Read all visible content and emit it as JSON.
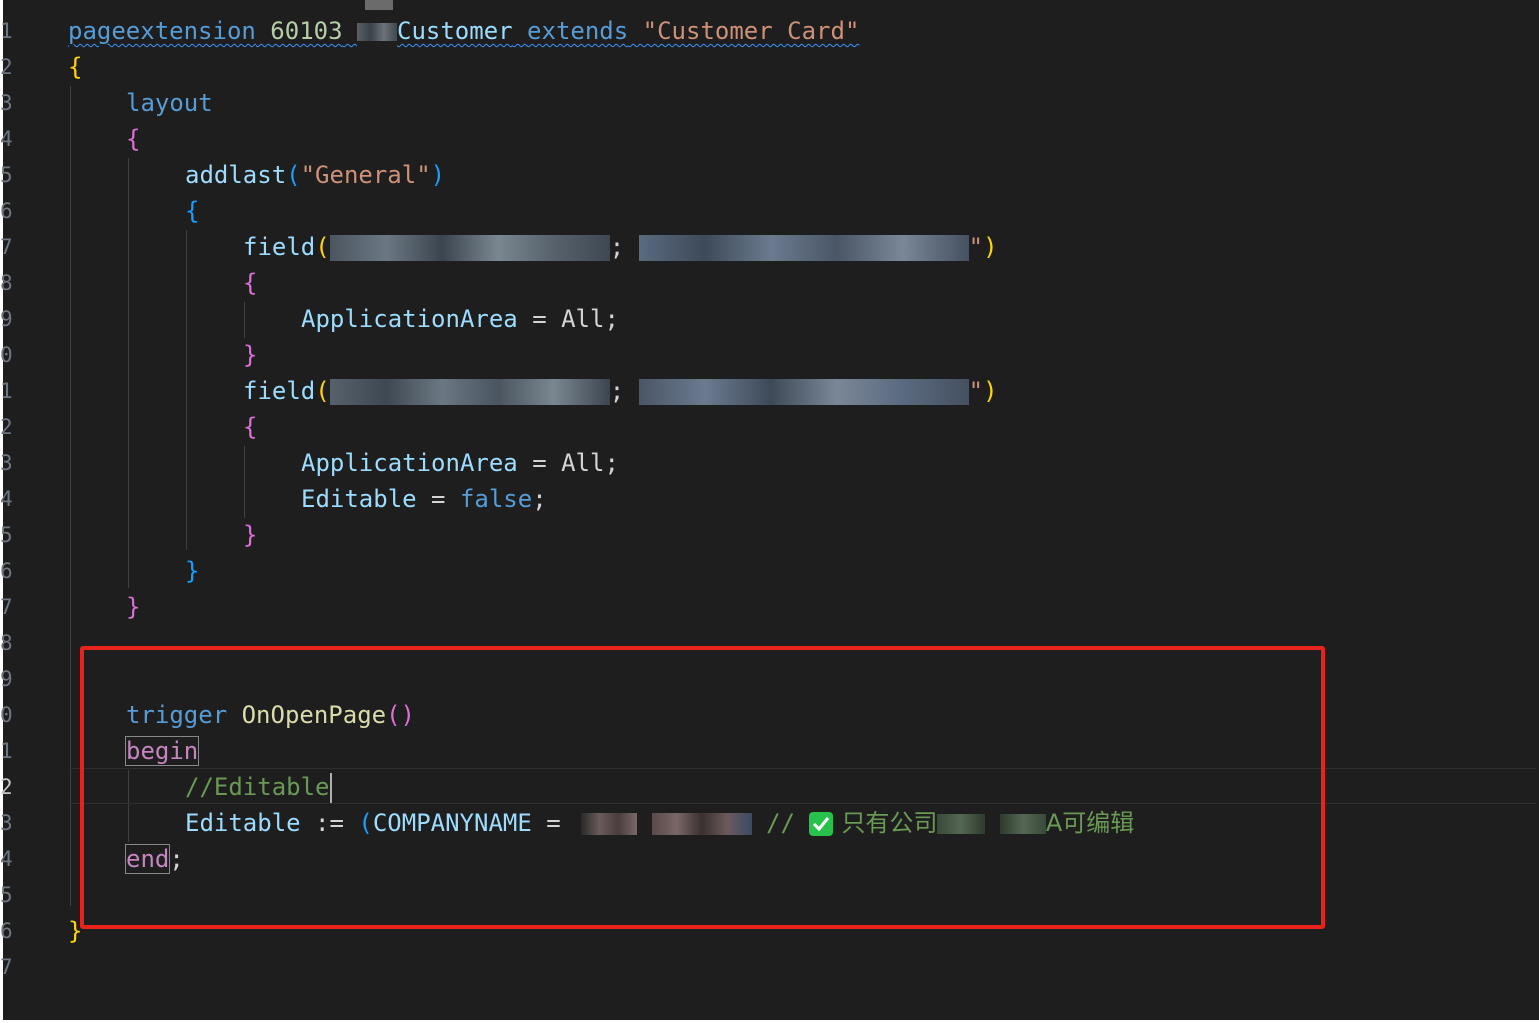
{
  "line_numbers": [
    "1",
    "2",
    "3",
    "4",
    "5",
    "6",
    "7",
    "8",
    "9",
    "0",
    "1",
    "2",
    "3",
    "4",
    "5",
    "6",
    "7",
    "8",
    "9",
    "0",
    "1",
    "2",
    "3",
    "4",
    "5",
    "6",
    "7"
  ],
  "active_line_index": 21,
  "code": {
    "l1": {
      "kw": "pageextension",
      "num": "60103",
      "name_tail": "Customer",
      "extends_kw": "extends",
      "target": "\"Customer Card\""
    },
    "l2": {
      "brace": "{"
    },
    "l3": {
      "kw": "layout"
    },
    "l4": {
      "brace": "{"
    },
    "l5": {
      "fn": "addlast",
      "open": "(",
      "arg": "\"General\"",
      "close": ")"
    },
    "l6": {
      "brace": "{"
    },
    "l7": {
      "kw": "field",
      "open": "(",
      "sep": ";",
      "close_quote": "\"",
      "close": ")"
    },
    "l8": {
      "brace": "{"
    },
    "l9": {
      "prop": "ApplicationArea",
      "eq": "=",
      "val": "All",
      "semi": ";"
    },
    "l10": {
      "brace": "}"
    },
    "l11": {
      "kw": "field",
      "open": "(",
      "sep": ";",
      "close_quote": "\"",
      "close": ")"
    },
    "l12": {
      "brace": "{"
    },
    "l13": {
      "prop": "ApplicationArea",
      "eq": "=",
      "val": "All",
      "semi": ";"
    },
    "l14": {
      "prop": "Editable",
      "eq": "=",
      "val": "false",
      "semi": ";"
    },
    "l15": {
      "brace": "}"
    },
    "l16": {
      "brace": "}"
    },
    "l17": {
      "brace": "}"
    },
    "l20": {
      "kw": "trigger",
      "fn": "OnOpenPage",
      "parens": "()"
    },
    "l21": {
      "kw": "begin"
    },
    "l22": {
      "comment": "//Editable"
    },
    "l23": {
      "prop": "Editable",
      "assign": ":=",
      "open": "(",
      "const": "COMPANYNAME",
      "eq": "=",
      "comment_slashes": "//",
      "cjk_a": "只有公司",
      "cjk_b": "A可编辑"
    },
    "l24": {
      "kw": "end",
      "semi": ";"
    },
    "l26": {
      "brace": "}"
    }
  },
  "colors": {
    "background": "#1e1e1e",
    "highlight_box": "#e8231c",
    "check_icon": "#27c24c"
  },
  "icons": {
    "check": "check-mark-icon"
  }
}
